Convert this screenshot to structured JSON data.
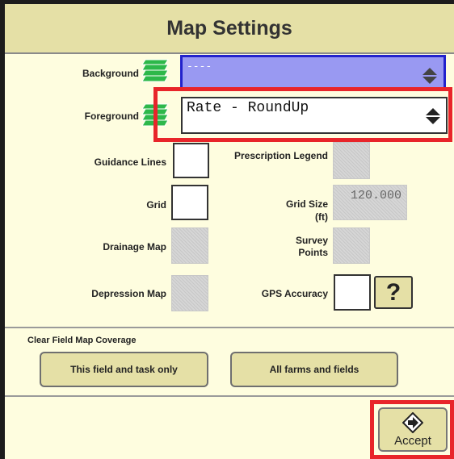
{
  "window": {
    "title": "Map Settings"
  },
  "layers": {
    "background": {
      "label": "Background",
      "value": "----"
    },
    "foreground": {
      "label": "Foreground",
      "value": "Rate - RoundUp"
    }
  },
  "options": {
    "guidance_lines": "Guidance Lines",
    "grid": "Grid",
    "drainage_map": "Drainage Map",
    "depression_map": "Depression Map",
    "prescription_legend": "Prescription Legend",
    "grid_size_label": "Grid Size",
    "grid_size_unit": "(ft)",
    "grid_size_value": "120.000",
    "survey_points_line1": "Survey",
    "survey_points_line2": "Points",
    "gps_accuracy": "GPS Accuracy",
    "help_glyph": "?"
  },
  "clear_coverage": {
    "heading": "Clear Field Map Coverage",
    "this_field_button": "This field and task only",
    "all_farms_button": "All farms and fields"
  },
  "footer": {
    "accept_label": "Accept",
    "accept_icon": "accept-diamond-arrow-icon"
  },
  "colors": {
    "panel_background": "#FEFDDF",
    "title_bar": "#E5E0A6",
    "background_dropdown_fill": "#9999F2",
    "background_dropdown_border": "#2222CC",
    "highlight_red": "#E8252A",
    "layer_icon_green": "#2DB84A"
  }
}
